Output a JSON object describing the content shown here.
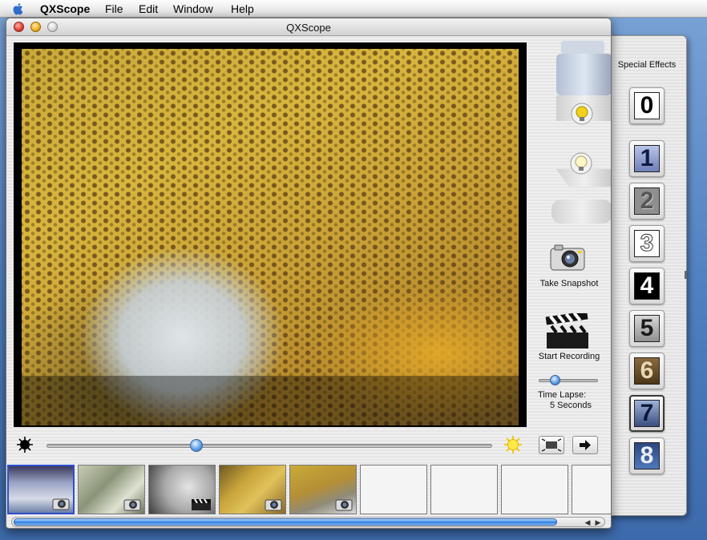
{
  "menubar": {
    "app_name": "QXScope",
    "items": [
      "File",
      "Edit",
      "Window",
      "Help"
    ]
  },
  "window": {
    "title": "QXScope"
  },
  "controls": {
    "snapshot_label": "Take Snapshot",
    "record_label": "Start Recording",
    "time_lapse_label": "Time Lapse:",
    "time_lapse_value": "5 Seconds",
    "brightness_level": 0.33,
    "time_lapse_level": 0.2
  },
  "effects": {
    "title": "Special Effects",
    "buttons": [
      "0",
      "1",
      "2",
      "3",
      "4",
      "5",
      "6",
      "7",
      "8"
    ]
  },
  "thumbnails": [
    {
      "type": "snapshot",
      "selected": true
    },
    {
      "type": "snapshot",
      "selected": false
    },
    {
      "type": "recording",
      "selected": false
    },
    {
      "type": "snapshot",
      "selected": false
    },
    {
      "type": "snapshot",
      "selected": false
    },
    {
      "type": "empty",
      "selected": false
    },
    {
      "type": "empty",
      "selected": false
    },
    {
      "type": "empty",
      "selected": false
    },
    {
      "type": "empty",
      "selected": false
    }
  ],
  "icons": {
    "apple": "apple-icon",
    "light_top": "lightbulb-on-icon",
    "light_bottom": "lightbulb-off-icon",
    "snapshot": "camera-icon",
    "record": "clapperboard-icon",
    "dark": "dark-sun-icon",
    "bright": "bright-sun-icon",
    "fullscreen": "fullscreen-icon",
    "export": "arrow-right-icon"
  },
  "colors": {
    "accent": "#2c76d8",
    "selection_border": "#2d4fcf",
    "bulb_on": "#f2d21a"
  }
}
